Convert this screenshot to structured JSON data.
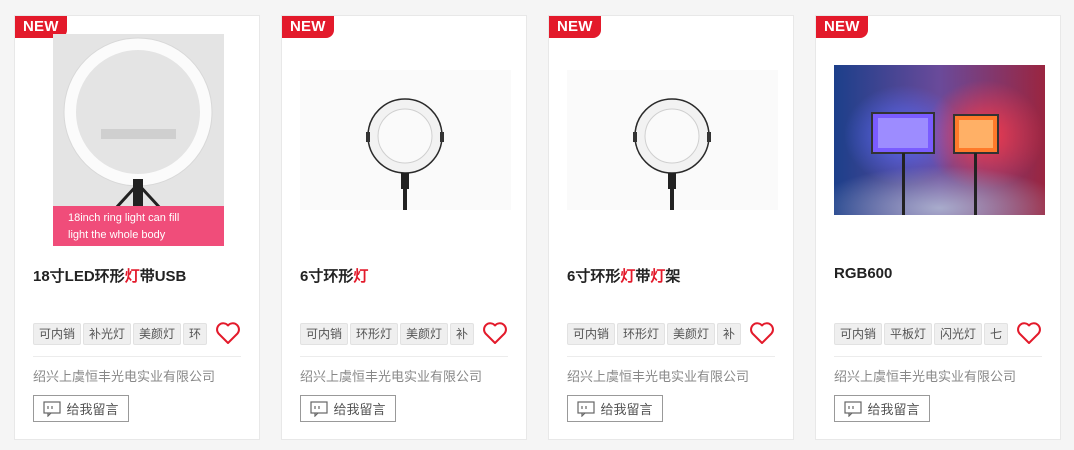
{
  "cards": [
    {
      "badge": "NEW",
      "title_a": "18寸LED环形",
      "title_hl1": "灯",
      "title_b": "带USB",
      "title_hl2": "",
      "title_c": "",
      "tags": [
        "可内销",
        "补光灯",
        "美颜灯",
        "环"
      ],
      "image_caption": "18inch ring light can fill light the whole body",
      "company": "绍兴上虞恒丰光电实业有限公司",
      "message_btn": "给我留言",
      "heart_icon": "heart-icon"
    },
    {
      "badge": "NEW",
      "title_a": "6寸环形",
      "title_hl1": "灯",
      "title_b": "",
      "title_hl2": "",
      "title_c": "",
      "tags": [
        "可内销",
        "环形灯",
        "美颜灯",
        "补"
      ],
      "company": "绍兴上虞恒丰光电实业有限公司",
      "message_btn": "给我留言",
      "heart_icon": "heart-icon"
    },
    {
      "badge": "NEW",
      "title_a": "6寸环形",
      "title_hl1": "灯",
      "title_b": "带",
      "title_hl2": "灯",
      "title_c": "架",
      "tags": [
        "可内销",
        "环形灯",
        "美颜灯",
        "补"
      ],
      "company": "绍兴上虞恒丰光电实业有限公司",
      "message_btn": "给我留言",
      "heart_icon": "heart-icon"
    },
    {
      "badge": "NEW",
      "title_a": "RGB600",
      "title_hl1": "",
      "title_b": "",
      "title_hl2": "",
      "title_c": "",
      "tags": [
        "可内销",
        "平板灯",
        "闪光灯",
        "七"
      ],
      "company": "绍兴上虞恒丰光电实业有限公司",
      "message_btn": "给我留言",
      "heart_icon": "heart-icon"
    }
  ],
  "colors": {
    "accent": "#e31a2b",
    "tag_bg": "#efefef",
    "company_text": "#888888"
  }
}
